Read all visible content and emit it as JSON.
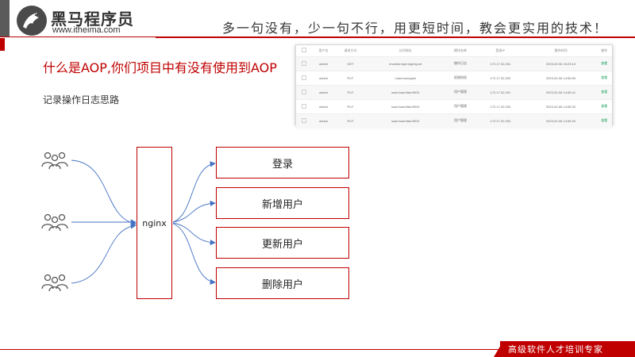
{
  "header": {
    "logo_cn": "黑马程序员",
    "logo_url": "www.itheima.com",
    "slogan": "多一句没有，少一句不行，用更短时间，教会更实用的技术！",
    "accent": "#c00000"
  },
  "main": {
    "title": "什么是AOP,你们项目中有没有使用到AOP",
    "subtitle": "记录操作日志思路"
  },
  "log_table": {
    "columns": [
      "",
      "用户名",
      "请求方式",
      "访问地址",
      "模块名称",
      "登录IP",
      "操作时间",
      "操作"
    ],
    "rows": [
      [
        "admin",
        "GET",
        "/monitor/operlog/export",
        "操作日志",
        "172.17.32.251",
        "2023-02-06 15:29:19",
        "查看"
      ],
      [
        "admin",
        "PUT",
        "/user/user/gain",
        "权限授权",
        "172.17.32.253",
        "2023-02-06 14:55:50",
        "查看"
      ],
      [
        "admin",
        "PUT",
        "/user/user/fahr/9001",
        "用户管理",
        "172.17.32.251",
        "2023-02-06 14:55:41",
        "查看"
      ],
      [
        "admin",
        "PUT",
        "/user/user/fahr/9002",
        "用户管理",
        "172.17.32.253",
        "2023-02-06 14:55:32",
        "查看"
      ],
      [
        "admin",
        "PUT",
        "/user/user/fahr/9001",
        "用户管理",
        "172.17.32.253",
        "2023-02-06 14:55:20",
        "查看"
      ]
    ]
  },
  "diagram": {
    "nginx_label": "nginx",
    "boxes": [
      "登录",
      "新增用户",
      "更新用户",
      "删除用户"
    ],
    "users_icon": "users-icon"
  },
  "footer": {
    "text": "高级软件人才培训专家"
  }
}
